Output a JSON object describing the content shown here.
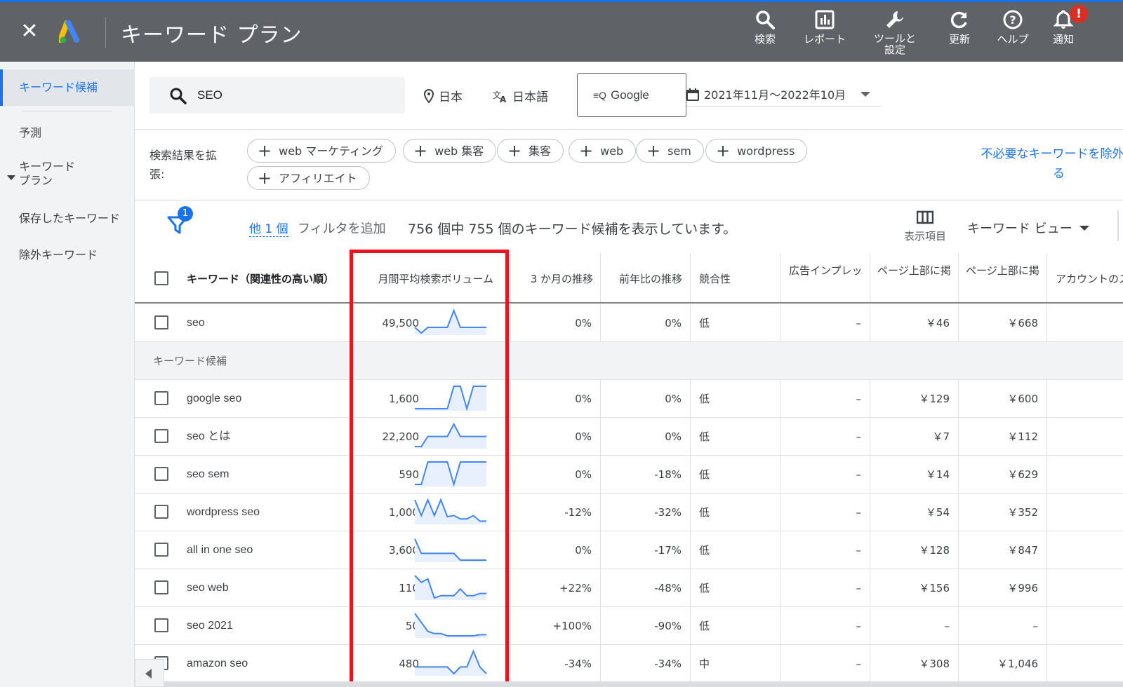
{
  "header": {
    "title": "キーワード プラン",
    "tools": [
      {
        "icon": "search-icon",
        "label": "検索"
      },
      {
        "icon": "report-icon",
        "label": "レポート"
      },
      {
        "icon": "wrench-icon",
        "label": "ツールと",
        "label2": "設定"
      },
      {
        "icon": "refresh-icon",
        "label": "更新"
      },
      {
        "icon": "help-icon",
        "label": "ヘルプ"
      },
      {
        "icon": "bell-icon",
        "label": "通知",
        "badge": "!"
      }
    ]
  },
  "sidebar": {
    "items": [
      {
        "label": "キーワード候補",
        "active": true
      },
      {
        "label": "予測"
      },
      {
        "label": "キーワード",
        "label2": "プラン"
      },
      {
        "label": "保存したキーワード"
      },
      {
        "label": "除外キーワード"
      }
    ]
  },
  "search": {
    "value": "SEO",
    "location": "日本",
    "language": "日本語",
    "network": "Google",
    "date_range": "2021年11月～2022年10月"
  },
  "broaden": {
    "label": "検索結果を拡張:",
    "chips": [
      "web マーケティング",
      "web 集客",
      "集客",
      "web",
      "sem",
      "wordpress",
      "アフィリエイト"
    ],
    "exclude_link_line1": "不必要なキーワードを除外す",
    "exclude_link_line2": "る"
  },
  "filter_bar": {
    "badge": "1",
    "other_link": "他 1 個",
    "add_filter": "フィルタを追加",
    "count_text": "756 個中 755 個のキーワード候補を表示しています。",
    "columns_label": "表示項目",
    "view_label": "キーワード ビュー"
  },
  "table": {
    "headers": {
      "keyword": "キーワード（関連性の高い順）",
      "volume": "月間平均検索ボリューム",
      "three_month": "3 か月の推移",
      "yoy": "前年比の推移",
      "competition": "競合性",
      "impression": "広告インプレッ",
      "top_low": "ページ上部に掲",
      "top_high": "ページ上部に掲",
      "account": "アカウントのステ"
    },
    "group_label": "キーワード候補",
    "first_row": {
      "keyword": "seo",
      "volume": "49,500",
      "three_month": "0%",
      "yoy": "0%",
      "competition": "低",
      "impression": "–",
      "top_low": "￥46",
      "top_high": "￥668",
      "trend": [
        0.25,
        0.0,
        0.25,
        0.25,
        0.25,
        0.25,
        1.0,
        0.25,
        0.25,
        0.25,
        0.25,
        0.25
      ]
    },
    "rows": [
      {
        "keyword": "google seo",
        "volume": "1,600",
        "three_month": "0%",
        "yoy": "0%",
        "competition": "低",
        "impression": "–",
        "top_low": "￥129",
        "top_high": "￥600",
        "trend": [
          0.0,
          0.0,
          0.0,
          0.0,
          0.0,
          0.0,
          1.0,
          1.0,
          0.0,
          1.0,
          1.0,
          1.0
        ]
      },
      {
        "keyword": "seo とは",
        "volume": "22,200",
        "three_month": "0%",
        "yoy": "0%",
        "competition": "低",
        "impression": "–",
        "top_low": "￥7",
        "top_high": "￥112",
        "trend": [
          0.0,
          0.0,
          0.45,
          0.45,
          0.45,
          0.45,
          1.0,
          0.45,
          0.45,
          0.45,
          0.45,
          0.45
        ]
      },
      {
        "keyword": "seo sem",
        "volume": "590",
        "three_month": "0%",
        "yoy": "-18%",
        "competition": "低",
        "impression": "–",
        "top_low": "￥14",
        "top_high": "￥629",
        "trend": [
          0.0,
          0.0,
          1.0,
          1.0,
          1.0,
          1.0,
          0.0,
          1.0,
          1.0,
          1.0,
          1.0,
          1.0
        ]
      },
      {
        "keyword": "wordpress seo",
        "volume": "1,000",
        "three_month": "-12%",
        "yoy": "-32%",
        "competition": "低",
        "impression": "–",
        "top_low": "￥54",
        "top_high": "￥352",
        "trend": [
          1.0,
          0.3,
          1.0,
          0.3,
          1.0,
          0.25,
          0.3,
          0.15,
          0.15,
          0.3,
          0.05,
          0.05
        ]
      },
      {
        "keyword": "all in one seo",
        "volume": "3,600",
        "three_month": "0%",
        "yoy": "-17%",
        "competition": "低",
        "impression": "–",
        "top_low": "￥128",
        "top_high": "￥847",
        "trend": [
          0.95,
          0.3,
          0.3,
          0.3,
          0.3,
          0.3,
          0.3,
          0.0,
          0.0,
          0.0,
          0.0,
          0.0
        ]
      },
      {
        "keyword": "seo web",
        "volume": "110",
        "three_month": "+22%",
        "yoy": "-48%",
        "competition": "低",
        "impression": "–",
        "top_low": "￥156",
        "top_high": "￥996",
        "trend": [
          1.0,
          0.7,
          0.85,
          0.0,
          0.1,
          0.1,
          0.1,
          0.4,
          0.1,
          0.1,
          0.2,
          0.2
        ]
      },
      {
        "keyword": "seo 2021",
        "volume": "50",
        "three_month": "+100%",
        "yoy": "-90%",
        "competition": "低",
        "impression": "–",
        "top_low": "–",
        "top_high": "–",
        "trend": [
          1.0,
          0.6,
          0.2,
          0.1,
          0.1,
          0.0,
          0.0,
          0.0,
          0.0,
          0.0,
          0.05,
          0.05
        ]
      },
      {
        "keyword": "amazon seo",
        "volume": "480",
        "three_month": "-34%",
        "yoy": "-34%",
        "competition": "中",
        "impression": "–",
        "top_low": "￥308",
        "top_high": "￥1,046",
        "trend": [
          0.3,
          0.3,
          0.3,
          0.3,
          0.3,
          0.3,
          0.0,
          0.3,
          0.3,
          1.0,
          0.3,
          0.0
        ]
      }
    ]
  },
  "colors": {
    "accent": "#1a73e8",
    "header_bg": "#5f6368",
    "highlight": "#e8141e",
    "spark_line": "#4285f4",
    "spark_fill": "#e8f0fe"
  }
}
